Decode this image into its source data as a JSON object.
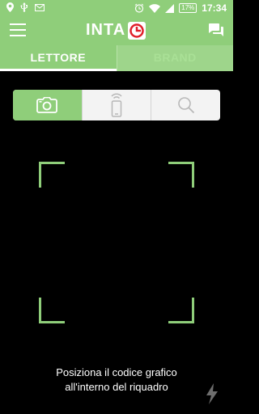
{
  "status_bar": {
    "battery": "17%",
    "time": "17:34"
  },
  "app_bar": {
    "logo_text": "INTA",
    "icons": [
      "menu-icon",
      "logo-clock-icon",
      "chat-icon"
    ]
  },
  "tabs": [
    {
      "label": "LETTORE",
      "active": true
    },
    {
      "label": "BRAND",
      "active": false
    }
  ],
  "scan_modes": [
    {
      "icon": "camera-icon",
      "selected": true
    },
    {
      "icon": "nfc-phone-icon",
      "selected": false
    },
    {
      "icon": "search-icon",
      "selected": false
    }
  ],
  "instructions": {
    "line1": "Posiziona il codice grafico",
    "line2": "all'interno del riquadro"
  },
  "colors": {
    "accent": "#8fce7a",
    "background": "#000000",
    "logo_red": "#e0202a"
  }
}
